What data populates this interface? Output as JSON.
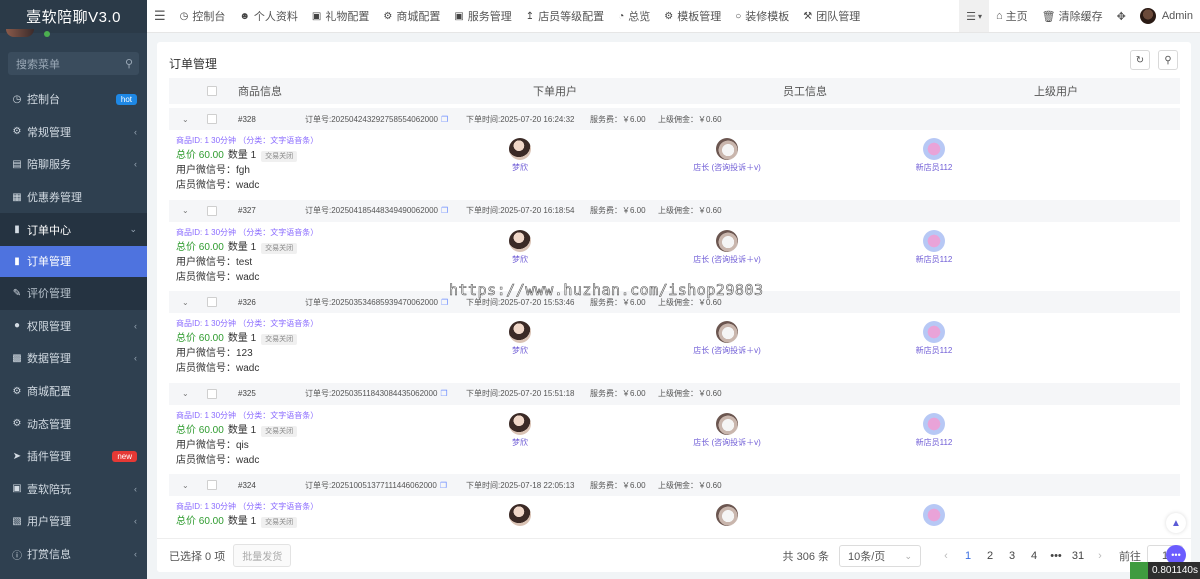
{
  "app": {
    "title": "壹软陪聊V3.0"
  },
  "sidebar": {
    "search_placeholder": "搜索菜单",
    "items": [
      {
        "label": "控制台",
        "icon": "dashboard-icon",
        "badge": "hot"
      },
      {
        "label": "常规管理",
        "icon": "cogs-icon"
      },
      {
        "label": "陪聊服务",
        "icon": "chat-icon"
      },
      {
        "label": "优惠券管理",
        "icon": "ticket-icon"
      },
      {
        "label": "订单中心",
        "icon": "file-icon"
      },
      {
        "label": "订单管理",
        "icon": "file-icon"
      },
      {
        "label": "评价管理",
        "icon": "edit-icon"
      },
      {
        "label": "权限管理",
        "icon": "group-icon"
      },
      {
        "label": "数据管理",
        "icon": "chart-icon"
      },
      {
        "label": "商城配置",
        "icon": "cogs-icon"
      },
      {
        "label": "动态管理",
        "icon": "cogs-icon"
      },
      {
        "label": "插件管理",
        "icon": "rocket-icon",
        "badge": "new"
      },
      {
        "label": "壹软陪玩",
        "icon": "gift-icon"
      },
      {
        "label": "用户管理",
        "icon": "id-card-icon"
      },
      {
        "label": "打赏信息",
        "icon": "info-icon"
      }
    ]
  },
  "topbar": {
    "tabs": [
      "控制台",
      "个人资料",
      "礼物配置",
      "商城配置",
      "服务管理",
      "店员等级配置",
      "总览",
      "模板管理",
      "装修模板",
      "团队管理"
    ],
    "home": "主页",
    "clear_cache": "清除缓存",
    "admin": "Admin"
  },
  "panel": {
    "title": "订单管理",
    "headers": [
      "商品信息",
      "下单用户",
      "员工信息",
      "上级用户"
    ]
  },
  "orders": [
    {
      "id": "#328",
      "no": "订单号:20250424329275855406200​0",
      "time": "下单时间:2025-07-20 16:24:32",
      "fee": "服务费：￥6.00",
      "comm": "上级佣金：￥0.60",
      "pid": "商品ID: 1 30分钟 （分类：文字语音条）",
      "total": "总价 60.00",
      "qty": "数量 1",
      "status": "交易关闭",
      "wx_user": "用户微信号：fgh",
      "wx_shop": "店员微信号：wadc",
      "buyer": "梦欣",
      "staff": "店长 (咨询投诉＋v)",
      "upline": "新店员112"
    },
    {
      "id": "#327",
      "no": "订单号:202504185448349490062000",
      "time": "下单时间:2025-07-20 16:18:54",
      "fee": "服务费：￥6.00",
      "comm": "上级佣金：￥0.60",
      "pid": "商品ID: 1 30分钟 （分类：文字语音条）",
      "total": "总价 60.00",
      "qty": "数量 1",
      "status": "交易关闭",
      "wx_user": "用户微信号：test",
      "wx_shop": "店员微信号：wadc",
      "buyer": "梦欣",
      "staff": "店长 (咨询投诉＋v)",
      "upline": "新店员112"
    },
    {
      "id": "#326",
      "no": "订单号:202503534685939470062000",
      "time": "下单时间:2025-07-20 15:53:46",
      "fee": "服务费：￥6.00",
      "comm": "上级佣金：￥0.60",
      "pid": "商品ID: 1 30分钟 （分类：文字语音条）",
      "total": "总价 60.00",
      "qty": "数量 1",
      "status": "交易关闭",
      "wx_user": "用户微信号：123",
      "wx_shop": "店员微信号：wadc",
      "buyer": "梦欣",
      "staff": "店长 (咨询投诉＋v)",
      "upline": "新店员112"
    },
    {
      "id": "#325",
      "no": "订单号:202503511843084435062000",
      "time": "下单时间:2025-07-20 15:51:18",
      "fee": "服务费：￥6.00",
      "comm": "上级佣金：￥0.60",
      "pid": "商品ID: 1 30分钟 （分类：文字语音条）",
      "total": "总价 60.00",
      "qty": "数量 1",
      "status": "交易关闭",
      "wx_user": "用户微信号：qis",
      "wx_shop": "店员微信号：wadc",
      "buyer": "梦欣",
      "staff": "店长 (咨询投诉＋v)",
      "upline": "新店员112"
    },
    {
      "id": "#324",
      "no": "订单号:202510051377111446062000",
      "time": "下单时间:2025-07-18 22:05:13",
      "fee": "服务费：￥6.00",
      "comm": "上级佣金：￥0.60",
      "pid": "商品ID: 1 30分钟 （分类：文字语音条）",
      "total": "总价 60.00",
      "qty": "数量 1",
      "status": "交易关闭",
      "wx_user": "",
      "wx_shop": "",
      "buyer": "",
      "staff": "",
      "upline": ""
    }
  ],
  "footer": {
    "selected": "已选择 0 项",
    "bulk": "批量发货",
    "total": "共 306 条",
    "page_size": "10条/页",
    "pages": [
      "1",
      "2",
      "3",
      "4",
      "•••",
      "31"
    ],
    "goto_label": "前往",
    "goto_value": "1"
  },
  "watermark": "https://www.huzhan.com/ishop29803",
  "timer": "0.801140s",
  "colors": {
    "sidebar": "#2f4050",
    "active": "#4e73df",
    "accent_purple": "#6f5cd6",
    "total_green": "#2e9b2e"
  }
}
